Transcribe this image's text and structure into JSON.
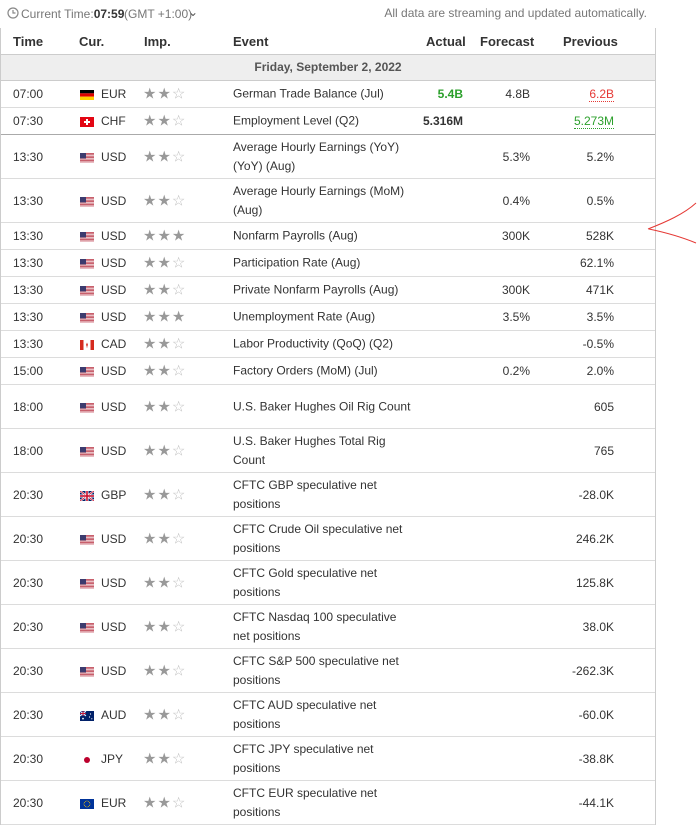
{
  "header": {
    "current_time_label": "Current Time:",
    "current_time": "07:59",
    "timezone": "(GMT +1:00)",
    "streaming_note": "All data are streaming and updated automatically."
  },
  "columns": {
    "time": "Time",
    "currency": "Cur.",
    "importance": "Imp.",
    "event": "Event",
    "actual": "Actual",
    "forecast": "Forecast",
    "previous": "Previous"
  },
  "date_header": "Friday, September 2, 2022",
  "rows": [
    {
      "time": "07:00",
      "flag": "de",
      "currency": "EUR",
      "importance": 2,
      "event": "German Trade Balance (Jul)",
      "actual": "5.4B",
      "actual_status": "better",
      "forecast": "4.8B",
      "previous": "6.2B",
      "previous_status": "revised-down"
    },
    {
      "time": "07:30",
      "flag": "ch",
      "currency": "CHF",
      "importance": 2,
      "event": "Employment Level (Q2)",
      "actual": "5.316M",
      "actual_status": "neutral",
      "forecast": "",
      "previous": "5.273M",
      "previous_status": "revised-up"
    },
    {
      "time": "13:30",
      "flag": "us",
      "currency": "USD",
      "importance": 2,
      "event": "Average Hourly Earnings (YoY) (YoY) (Aug)",
      "actual": "",
      "forecast": "5.3%",
      "previous": "5.2%"
    },
    {
      "time": "13:30",
      "flag": "us",
      "currency": "USD",
      "importance": 2,
      "event": "Average Hourly Earnings (MoM) (Aug)",
      "actual": "",
      "forecast": "0.4%",
      "previous": "0.5%"
    },
    {
      "time": "13:30",
      "flag": "us",
      "currency": "USD",
      "importance": 3,
      "event": "Nonfarm Payrolls (Aug)",
      "actual": "",
      "forecast": "300K",
      "previous": "528K"
    },
    {
      "time": "13:30",
      "flag": "us",
      "currency": "USD",
      "importance": 2,
      "event": "Participation Rate (Aug)",
      "actual": "",
      "forecast": "",
      "previous": "62.1%"
    },
    {
      "time": "13:30",
      "flag": "us",
      "currency": "USD",
      "importance": 2,
      "event": "Private Nonfarm Payrolls (Aug)",
      "actual": "",
      "forecast": "300K",
      "previous": "471K"
    },
    {
      "time": "13:30",
      "flag": "us",
      "currency": "USD",
      "importance": 3,
      "event": "Unemployment Rate (Aug)",
      "actual": "",
      "forecast": "3.5%",
      "previous": "3.5%"
    },
    {
      "time": "13:30",
      "flag": "ca",
      "currency": "CAD",
      "importance": 2,
      "event": "Labor Productivity (QoQ) (Q2)",
      "actual": "",
      "forecast": "",
      "previous": "-0.5%"
    },
    {
      "time": "15:00",
      "flag": "us",
      "currency": "USD",
      "importance": 2,
      "event": "Factory Orders (MoM) (Jul)",
      "actual": "",
      "forecast": "0.2%",
      "previous": "2.0%"
    },
    {
      "time": "18:00",
      "flag": "us",
      "currency": "USD",
      "importance": 2,
      "event": "U.S. Baker Hughes Oil Rig Count",
      "actual": "",
      "forecast": "",
      "previous": "605"
    },
    {
      "time": "18:00",
      "flag": "us",
      "currency": "USD",
      "importance": 2,
      "event": "U.S. Baker Hughes Total Rig Count",
      "actual": "",
      "forecast": "",
      "previous": "765"
    },
    {
      "time": "20:30",
      "flag": "gb",
      "currency": "GBP",
      "importance": 2,
      "event": "CFTC GBP speculative net positions",
      "actual": "",
      "forecast": "",
      "previous": "-28.0K"
    },
    {
      "time": "20:30",
      "flag": "us",
      "currency": "USD",
      "importance": 2,
      "event": "CFTC Crude Oil speculative net positions",
      "actual": "",
      "forecast": "",
      "previous": "246.2K"
    },
    {
      "time": "20:30",
      "flag": "us",
      "currency": "USD",
      "importance": 2,
      "event": "CFTC Gold speculative net positions",
      "actual": "",
      "forecast": "",
      "previous": "125.8K"
    },
    {
      "time": "20:30",
      "flag": "us",
      "currency": "USD",
      "importance": 2,
      "event": "CFTC Nasdaq 100 speculative net positions",
      "actual": "",
      "forecast": "",
      "previous": "38.0K"
    },
    {
      "time": "20:30",
      "flag": "us",
      "currency": "USD",
      "importance": 2,
      "event": "CFTC S&P 500 speculative net positions",
      "actual": "",
      "forecast": "",
      "previous": "-262.3K"
    },
    {
      "time": "20:30",
      "flag": "au",
      "currency": "AUD",
      "importance": 2,
      "event": "CFTC AUD speculative net positions",
      "actual": "",
      "forecast": "",
      "previous": "-60.0K"
    },
    {
      "time": "20:30",
      "flag": "jp",
      "currency": "JPY",
      "importance": 2,
      "event": "CFTC JPY speculative net positions",
      "actual": "",
      "forecast": "",
      "previous": "-38.8K"
    },
    {
      "time": "20:30",
      "flag": "eu",
      "currency": "EUR",
      "importance": 2,
      "event": "CFTC EUR speculative net positions",
      "actual": "",
      "forecast": "",
      "previous": "-44.1K"
    }
  ],
  "colors": {
    "better": "#2ca02c",
    "worse": "#e53935",
    "annotation": "#e53935"
  }
}
